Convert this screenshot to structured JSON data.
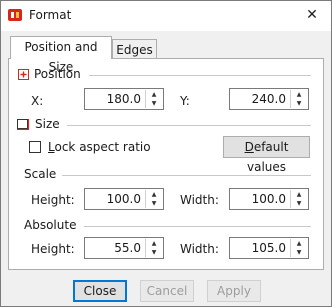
{
  "window": {
    "title": "Format",
    "close_glyph": "✕"
  },
  "tabs": [
    {
      "label": "Position and Size"
    },
    {
      "label": "Edges"
    }
  ],
  "position": {
    "heading": "Position",
    "x_label": "X:",
    "x_value": "180.0",
    "y_label": "Y:",
    "y_value": "240.0"
  },
  "size": {
    "heading": "Size",
    "lock_aspect_label": "Lock aspect ratio",
    "lock_aspect_checked": false,
    "default_values_label": "Default values",
    "scale": {
      "heading": "Scale",
      "height_label": "Height:",
      "height_value": "100.0",
      "width_label": "Width:",
      "width_value": "100.0"
    },
    "absolute": {
      "heading": "Absolute",
      "height_label": "Height:",
      "height_value": "55.0",
      "width_label": "Width:",
      "width_value": "105.0"
    }
  },
  "footer": {
    "close_label": "Close",
    "cancel_label": "Cancel",
    "apply_label": "Apply"
  },
  "colors": {
    "accent_red": "#d9261c",
    "focus_blue": "#0078d7"
  }
}
